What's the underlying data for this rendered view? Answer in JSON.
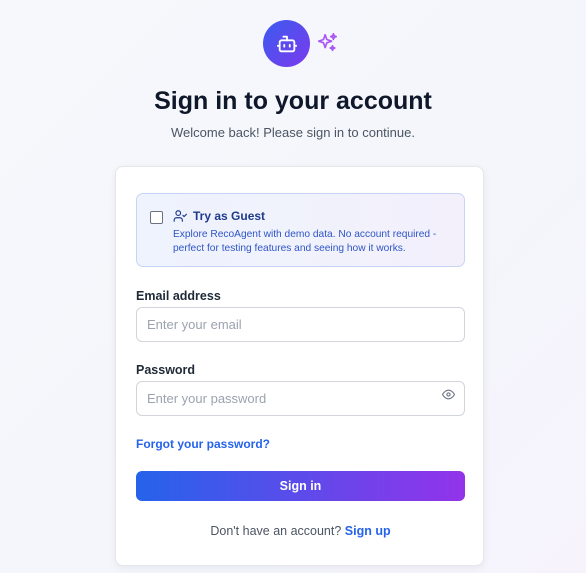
{
  "header": {
    "title": "Sign in to your account",
    "subtitle": "Welcome back! Please sign in to continue."
  },
  "icons": {
    "logo": "robot-icon",
    "sparkle": "sparkles-icon",
    "guest": "user-icon",
    "password_toggle": "eye-icon"
  },
  "guest": {
    "checked": false,
    "title": "Try as Guest",
    "description": "Explore RecoAgent with demo data. No account required - perfect for testing features and seeing how it works."
  },
  "form": {
    "email_label": "Email address",
    "email_placeholder": "Enter your email",
    "email_value": "",
    "password_label": "Password",
    "password_placeholder": "Enter your password",
    "password_value": "",
    "forgot_label": "Forgot your password?",
    "submit_label": "Sign in"
  },
  "footer": {
    "prompt": "Don't have an account?",
    "signup_label": "Sign up"
  },
  "colors": {
    "accent_blue": "#2563eb",
    "accent_purple": "#9333ea",
    "guest_title": "#1e3a8a"
  }
}
